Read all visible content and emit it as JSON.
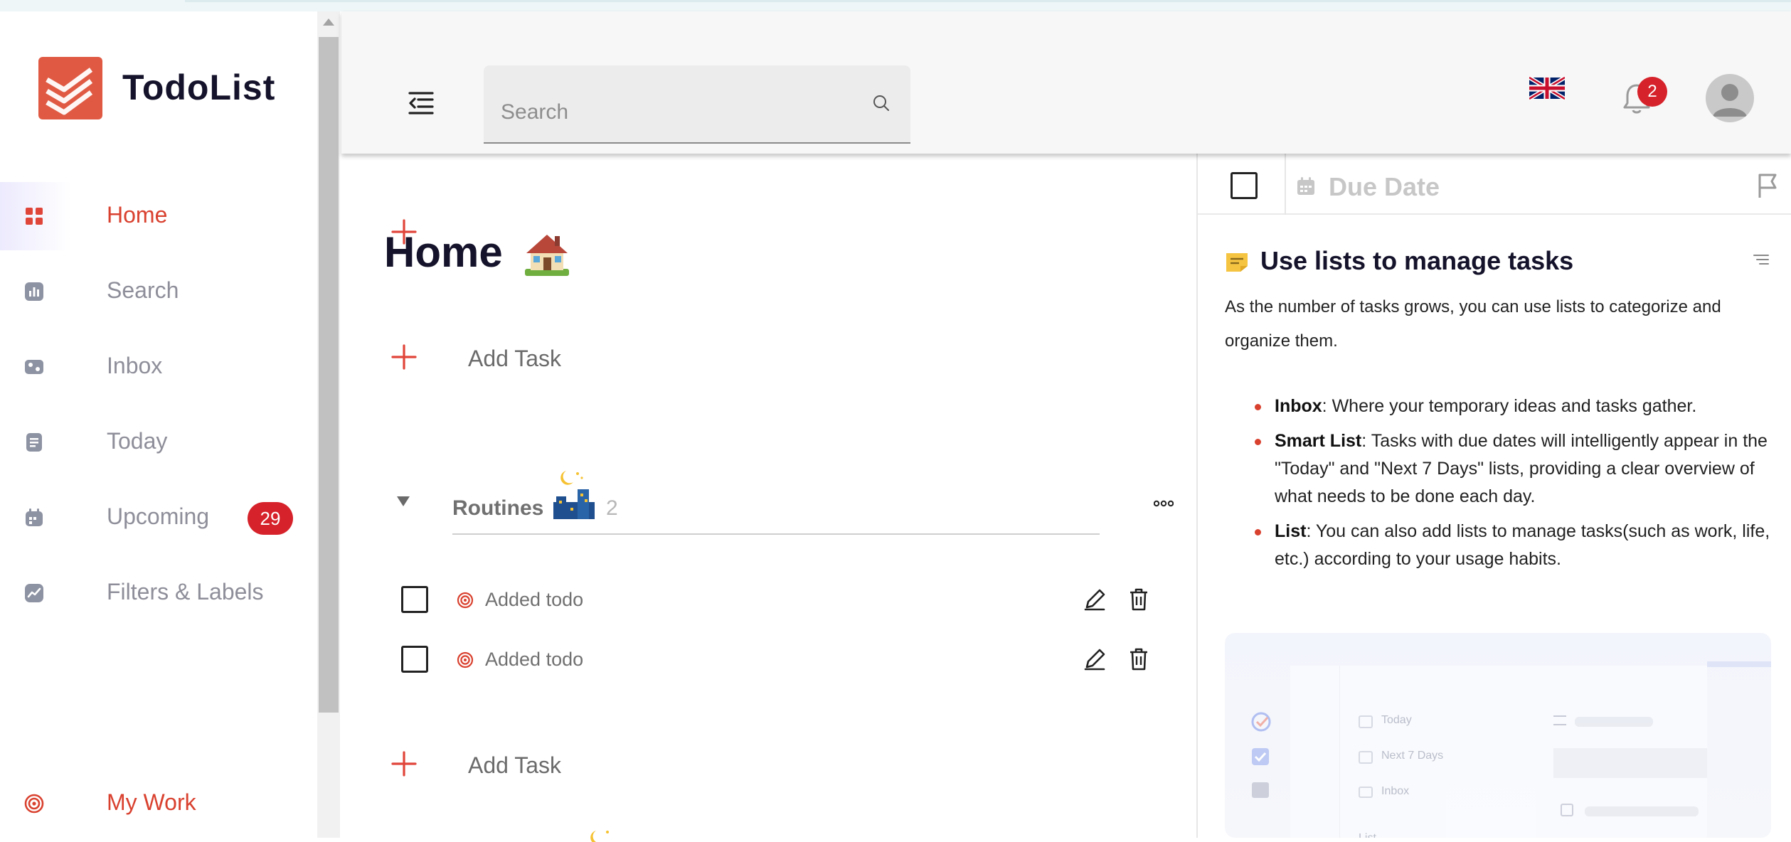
{
  "app": {
    "title": "TodoList"
  },
  "sidebar": {
    "items": [
      {
        "label": "Home",
        "icon": "grid-icon",
        "active": true
      },
      {
        "label": "Search",
        "icon": "chart-icon"
      },
      {
        "label": "Inbox",
        "icon": "inbox-icon"
      },
      {
        "label": "Today",
        "icon": "document-icon"
      },
      {
        "label": "Upcoming",
        "icon": "calendar-icon",
        "badge": "29"
      },
      {
        "label": "Filters & Labels",
        "icon": "trend-icon"
      }
    ],
    "project": {
      "label": "My Work",
      "icon": "target-icon"
    }
  },
  "header": {
    "search_placeholder": "Search",
    "notification_count": "2",
    "language_icon": "uk-flag-icon"
  },
  "main": {
    "title": "Home",
    "title_emoji": "house-emoji",
    "add_task_label": "Add Task",
    "section": {
      "name": "Routines",
      "emoji": "night-city-emoji",
      "count": "2"
    },
    "todos": [
      {
        "text": "Added todo"
      },
      {
        "text": "Added todo"
      }
    ]
  },
  "panel": {
    "due_date_placeholder": "Due Date",
    "heading": "Use lists to manage tasks",
    "intro": "As the number of tasks grows, you can use lists to categorize and organize them.",
    "bullets": [
      {
        "term": "Inbox",
        "text": ": Where your temporary ideas and tasks gather."
      },
      {
        "term": "Smart List",
        "text": ": Tasks with due dates will intelligently appear in the \"Today\" and \"Next 7 Days\" lists, providing a clear overview of what needs to be done each day."
      },
      {
        "term": "List",
        "text": ": You can also add lists to manage tasks(such as work, life, etc.) according to your usage habits."
      }
    ],
    "preview": {
      "items": [
        "Today",
        "Next 7 Days",
        "Inbox",
        "List"
      ]
    }
  },
  "colors": {
    "accent": "#d9412f",
    "badge": "#d6222a",
    "title": "#15132b"
  }
}
